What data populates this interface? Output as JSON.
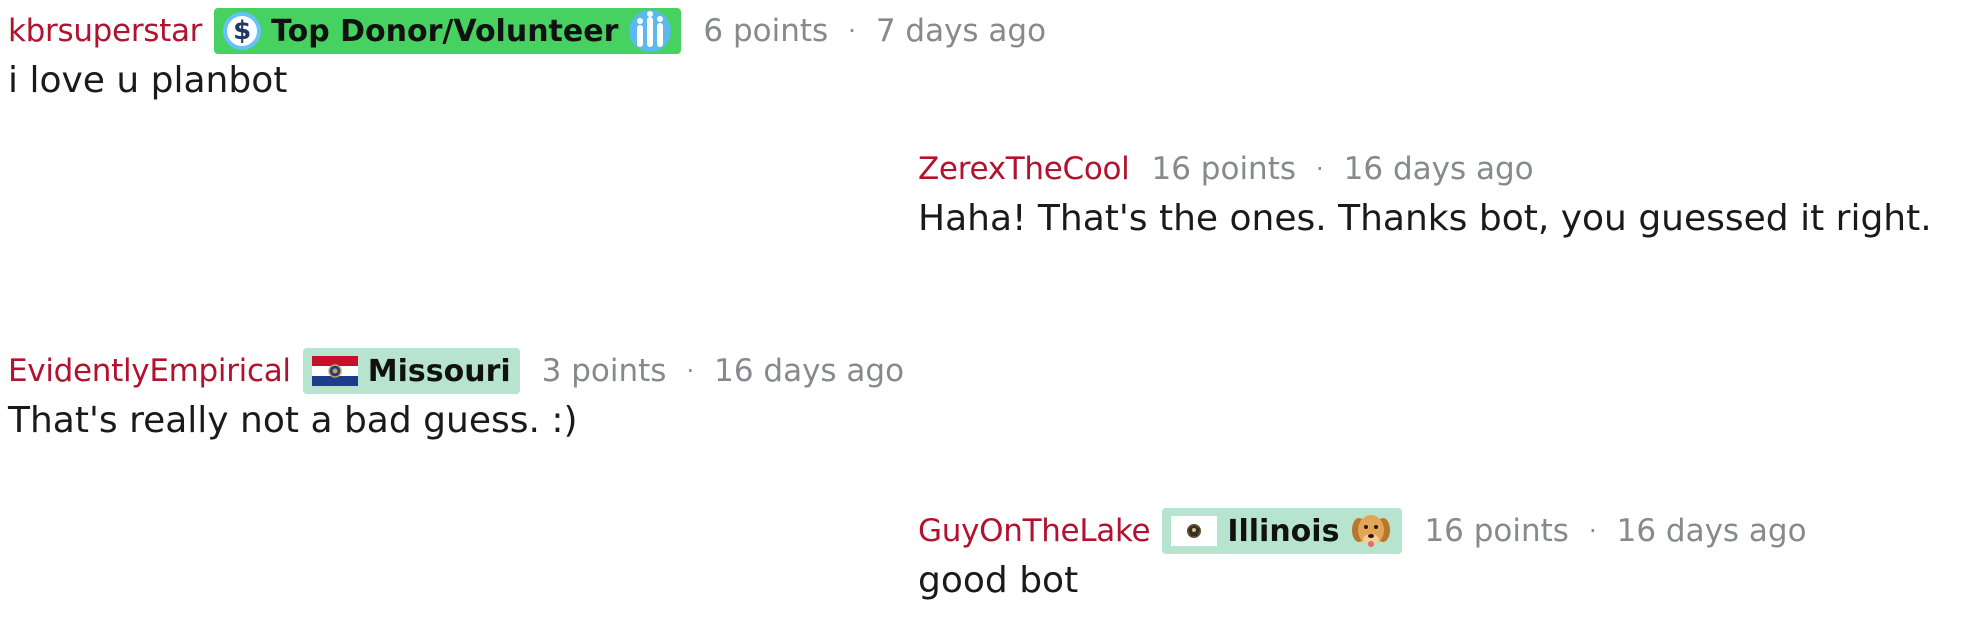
{
  "comments": [
    {
      "author": "kbrsuperstar",
      "flair": "Top Donor/Volunteer",
      "score": "6 points",
      "separator": "·",
      "time": "7 days ago",
      "text": "i love u planbot"
    },
    {
      "author": "ZerexTheCool",
      "score": "16 points",
      "separator": "·",
      "time": "16 days ago",
      "text": "Haha! That's the ones. Thanks bot, you guessed it right."
    },
    {
      "author": "EvidentlyEmpirical",
      "flair": "Missouri",
      "score": "3 points",
      "separator": "·",
      "time": "16 days ago",
      "text": "That's really not a bad guess. :)"
    },
    {
      "author": "GuyOnTheLake",
      "flair": "Illinois",
      "score": "16 points",
      "separator": "·",
      "time": "16 days ago",
      "text": "good bot"
    }
  ],
  "icons": {
    "donor": "dollar-coin-icon",
    "volunteer": "raised-hands-icon",
    "missouri": "missouri-flag-icon",
    "illinois": "illinois-flag-icon",
    "dog": "golden-retriever-icon"
  },
  "colors": {
    "author": "#b3122e",
    "meta": "#878a8c",
    "body": "#1a1a1b",
    "donor_flair": "#46d160",
    "state_flair": "#b7e4cf"
  }
}
